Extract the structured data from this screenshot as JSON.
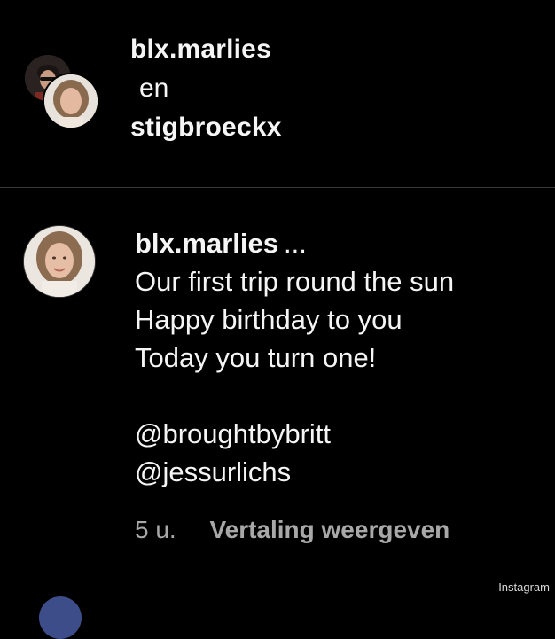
{
  "header": {
    "user1": "blx.marlies",
    "conjunction": "en",
    "user2": "stigbroeckx"
  },
  "comment": {
    "author": "blx.marlies",
    "more": "...",
    "lines": [
      "Our first trip round the sun",
      "Happy birthday to you",
      "Today you turn one!",
      "",
      "@broughtbybritt",
      "@jessurlichs"
    ],
    "time": "5 u.",
    "translate_label": "Vertaling weergeven"
  },
  "watermark": "Instagram"
}
